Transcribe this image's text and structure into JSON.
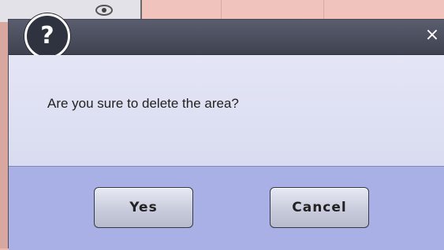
{
  "dialog": {
    "close_glyph": "×",
    "icon_glyph": "?",
    "icon_name": "question-icon",
    "message": "Are you sure to delete the area?",
    "buttons": {
      "yes": "Yes",
      "cancel": "Cancel"
    }
  },
  "colors": {
    "titlebar": "#4a4d5c",
    "content_bg": "#dcdff2",
    "button_bar_bg": "#a9b0e6"
  }
}
